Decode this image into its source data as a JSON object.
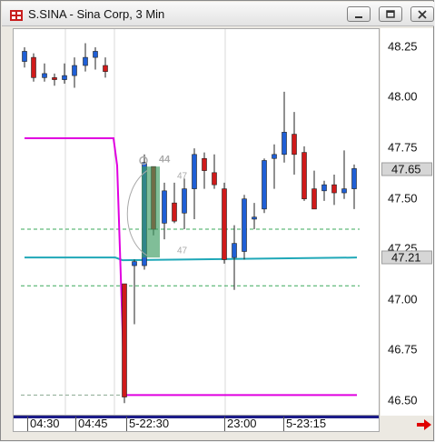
{
  "window": {
    "title": "S.SINA - Sina Corp, 3 Min"
  },
  "icons": {
    "app": "app-logo-icon",
    "minimize": "minimize-icon",
    "restore": "restore-icon",
    "close": "close-icon",
    "scroll_right": "scroll-right-arrow-icon"
  },
  "colors": {
    "up_candle": "#1f5fd6",
    "down_candle": "#d01a1a",
    "magenta_line": "#e000e0",
    "cyan_line": "#20a8b8",
    "dashed_green": "#3aa85a",
    "highlight_fill": "#3c9b61",
    "scroll_arrow": "#e00000"
  },
  "y_axis": {
    "ticks": [
      "48.25",
      "48.00",
      "47.75",
      "47.50",
      "47.25",
      "47.00",
      "46.75",
      "46.50"
    ],
    "last_price_label": "47.65",
    "cyan_price_label": "47.21"
  },
  "x_axis": {
    "ticks": [
      "04:30",
      "04:45",
      "5-22:30",
      "23:00",
      "5-23:15"
    ]
  },
  "annotations": {
    "order_icon_text": "44",
    "label_47_top": "47",
    "label_47_bottom": "47"
  },
  "chart_data": {
    "type": "candlestick",
    "title": "S.SINA - Sina Corp, 3 Min",
    "ylim": [
      46.45,
      48.33
    ],
    "candles": [
      {
        "o": 48.18,
        "h": 48.25,
        "l": 48.15,
        "c": 48.23
      },
      {
        "o": 48.2,
        "h": 48.22,
        "l": 48.08,
        "c": 48.1
      },
      {
        "o": 48.1,
        "h": 48.17,
        "l": 48.08,
        "c": 48.12
      },
      {
        "o": 48.1,
        "h": 48.12,
        "l": 48.06,
        "c": 48.09
      },
      {
        "o": 48.09,
        "h": 48.17,
        "l": 48.07,
        "c": 48.11
      },
      {
        "o": 48.11,
        "h": 48.2,
        "l": 48.05,
        "c": 48.16
      },
      {
        "o": 48.16,
        "h": 48.27,
        "l": 48.13,
        "c": 48.2
      },
      {
        "o": 48.2,
        "h": 48.25,
        "l": 48.14,
        "c": 48.23
      },
      {
        "o": 48.16,
        "h": 48.2,
        "l": 48.1,
        "c": 48.13
      },
      {
        "o": 47.08,
        "h": 47.08,
        "l": 46.49,
        "c": 46.52
      },
      {
        "o": 47.17,
        "h": 47.2,
        "l": 46.88,
        "c": 47.19
      },
      {
        "o": 47.17,
        "h": 47.72,
        "l": 47.15,
        "c": 47.68
      },
      {
        "o": 47.66,
        "h": 47.66,
        "l": 47.32,
        "c": 47.35
      },
      {
        "o": 47.38,
        "h": 47.58,
        "l": 47.3,
        "c": 47.54
      },
      {
        "o": 47.48,
        "h": 47.58,
        "l": 47.38,
        "c": 47.39
      },
      {
        "o": 47.43,
        "h": 47.6,
        "l": 47.35,
        "c": 47.55
      },
      {
        "o": 47.55,
        "h": 47.75,
        "l": 47.4,
        "c": 47.72
      },
      {
        "o": 47.7,
        "h": 47.73,
        "l": 47.55,
        "c": 47.64
      },
      {
        "o": 47.63,
        "h": 47.72,
        "l": 47.55,
        "c": 47.57
      },
      {
        "o": 47.55,
        "h": 47.58,
        "l": 47.18,
        "c": 47.2
      },
      {
        "o": 47.21,
        "h": 47.37,
        "l": 47.05,
        "c": 47.28
      },
      {
        "o": 47.24,
        "h": 47.52,
        "l": 47.2,
        "c": 47.5
      },
      {
        "o": 47.4,
        "h": 47.48,
        "l": 47.35,
        "c": 47.41
      },
      {
        "o": 47.45,
        "h": 47.7,
        "l": 47.43,
        "c": 47.69
      },
      {
        "o": 47.7,
        "h": 47.77,
        "l": 47.55,
        "c": 47.72
      },
      {
        "o": 47.72,
        "h": 48.03,
        "l": 47.68,
        "c": 47.83
      },
      {
        "o": 47.82,
        "h": 47.93,
        "l": 47.62,
        "c": 47.72
      },
      {
        "o": 47.73,
        "h": 47.76,
        "l": 47.49,
        "c": 47.5
      },
      {
        "o": 47.55,
        "h": 47.64,
        "l": 47.46,
        "c": 47.45
      },
      {
        "o": 47.54,
        "h": 47.59,
        "l": 47.49,
        "c": 47.57
      },
      {
        "o": 47.57,
        "h": 47.62,
        "l": 47.47,
        "c": 47.53
      },
      {
        "o": 47.53,
        "h": 47.74,
        "l": 47.5,
        "c": 47.55
      },
      {
        "o": 47.55,
        "h": 47.67,
        "l": 47.45,
        "c": 47.65
      }
    ],
    "lines": {
      "magenta_before": 47.8,
      "magenta_after": 46.53,
      "cyan": 47.21,
      "dashed_upper": 47.35,
      "dashed_lower": 47.07,
      "dashed_bottom": 46.53
    }
  }
}
